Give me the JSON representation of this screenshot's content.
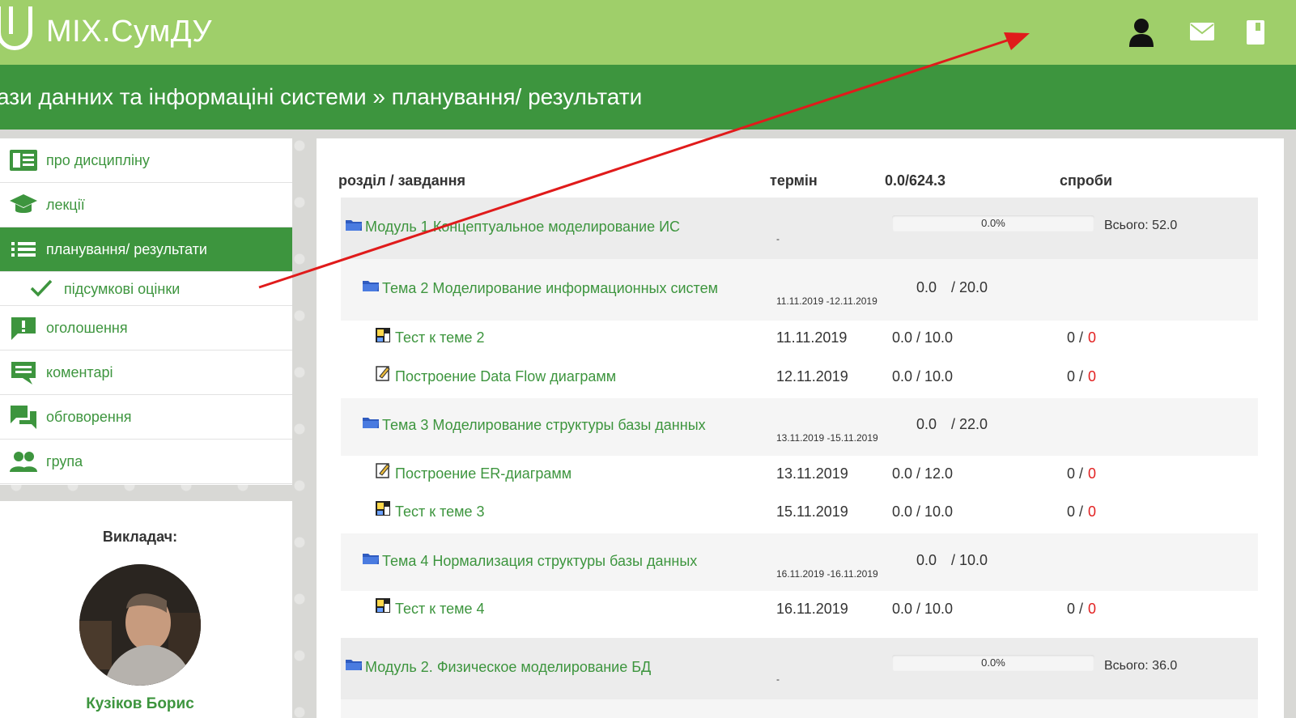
{
  "brand": {
    "name": "MIX.СумДУ"
  },
  "header_icons": [
    "user-icon",
    "mail-icon",
    "book-icon"
  ],
  "breadcrumb": "ази данних та інформаціні системи » планування/ результати",
  "sidebar": {
    "items": [
      {
        "label": "про дисципліну",
        "icon": "book-list-icon"
      },
      {
        "label": "лекції",
        "icon": "graduation-cap-icon"
      },
      {
        "label": "планування/ результати",
        "icon": "list-icon",
        "active": true
      },
      {
        "label": "оголошення",
        "icon": "announcement-icon"
      },
      {
        "label": "коментарі",
        "icon": "comment-icon"
      },
      {
        "label": "обговорення",
        "icon": "forum-icon"
      },
      {
        "label": "група",
        "icon": "group-icon"
      }
    ],
    "subitem": {
      "label": "підсумкові оцінки",
      "icon": "check-icon"
    }
  },
  "teacher": {
    "title": "Викладач:",
    "name": "Кузіков Борис"
  },
  "table": {
    "headers": {
      "section": "розділ / завдання",
      "deadline": "термін",
      "score": "0.0/624.3",
      "attempts": "спроби"
    },
    "modules": [
      {
        "title": "Модуль 1 Концептуальное моделирование ИС",
        "dash": "-",
        "progress": "0.0%",
        "progress_value": 0,
        "total": "Всього: 52.0"
      },
      {
        "title": "Модуль 2. Физическое моделирование БД",
        "dash": "-",
        "progress": "0.0%",
        "progress_value": 0,
        "total": "Всього: 36.0"
      }
    ],
    "topics": [
      {
        "title": "Тема 2 Моделирование информационных систем",
        "dates": "11.11.2019 -12.11.2019",
        "score": "0.0",
        "max": "/ 20.0"
      },
      {
        "title": "Тема 3 Моделирование структуры базы данных",
        "dates": "13.11.2019 -15.11.2019",
        "score": "0.0",
        "max": "/ 22.0"
      },
      {
        "title": "Тема 4 Нормализация структуры базы данных",
        "dates": "16.11.2019 -16.11.2019",
        "score": "0.0",
        "max": "/ 10.0"
      }
    ],
    "tasks": [
      {
        "title": "Тест к теме 2",
        "type": "test-icon",
        "date": "11.11.2019",
        "score": "0.0 / 10.0",
        "att_done": "0 /",
        "att_zero": "0"
      },
      {
        "title": "Построение Data Flow диаграмм",
        "type": "assignment-icon",
        "date": "12.11.2019",
        "score": "0.0 / 10.0",
        "att_done": "0 /",
        "att_zero": "0"
      },
      {
        "title": "Построение ER-диаграмм",
        "type": "assignment-icon",
        "date": "13.11.2019",
        "score": "0.0 / 12.0",
        "att_done": "0 /",
        "att_zero": "0"
      },
      {
        "title": "Тест к теме 3",
        "type": "test-icon",
        "date": "15.11.2019",
        "score": "0.0 / 10.0",
        "att_done": "0 /",
        "att_zero": "0"
      },
      {
        "title": "Тест к теме 4",
        "type": "test-icon",
        "date": "16.11.2019",
        "score": "0.0 / 10.0",
        "att_done": "0 /",
        "att_zero": "0"
      }
    ]
  },
  "colors": {
    "topbar": "#9fcf6a",
    "crumbbar": "#3d953e",
    "link": "#3d953e",
    "zero": "#e22121",
    "annotation_arrow": "#e01b1b"
  }
}
